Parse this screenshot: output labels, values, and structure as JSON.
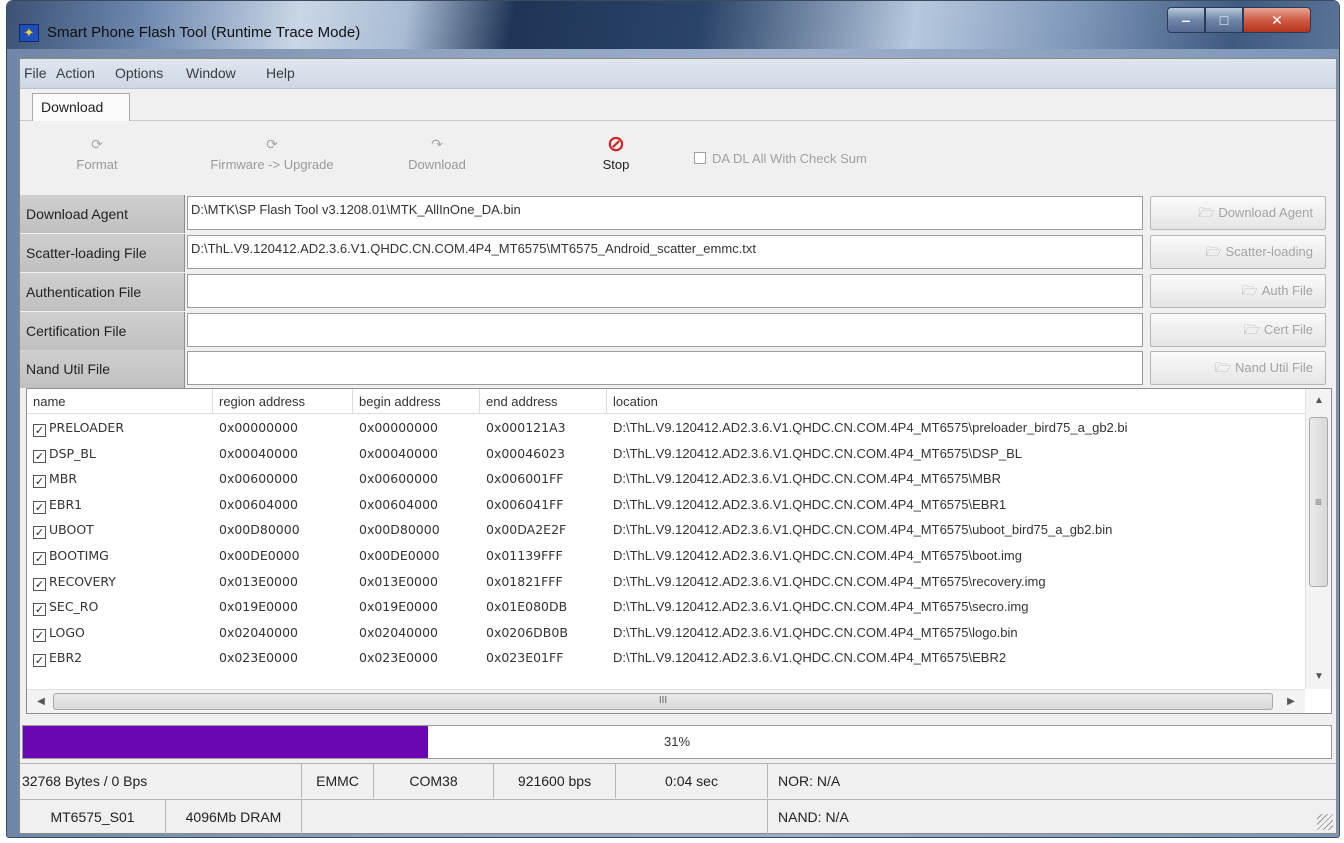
{
  "window": {
    "title": "Smart Phone Flash Tool (Runtime Trace Mode)",
    "minimize_label": "‒",
    "maximize_label": "□",
    "close_label": "✕"
  },
  "menu": [
    "File",
    "Action",
    "Options",
    "Window",
    "Help"
  ],
  "tabs": [
    "Download"
  ],
  "toolbar": {
    "format": "Format",
    "firmware_upgrade": "Firmware -> Upgrade",
    "download": "Download",
    "stop": "Stop",
    "checksum": "DA DL All With Check Sum"
  },
  "fields": {
    "download_agent": {
      "label": "Download Agent",
      "value": "D:\\MTK\\SP Flash Tool v3.1208.01\\MTK_AllInOne_DA.bin",
      "button": "Download Agent"
    },
    "scatter": {
      "label": "Scatter-loading File",
      "value": "D:\\ThL.V9.120412.AD2.3.6.V1.QHDC.CN.COM.4P4_MT6575\\MT6575_Android_scatter_emmc.txt",
      "button": "Scatter-loading"
    },
    "auth": {
      "label": "Authentication File",
      "value": "",
      "button": "Auth File"
    },
    "cert": {
      "label": "Certification File",
      "value": "",
      "button": "Cert File"
    },
    "nand": {
      "label": "Nand Util File",
      "value": "",
      "button": "Nand Util File"
    }
  },
  "table": {
    "columns": [
      "name",
      "region address",
      "begin address",
      "end address",
      "location"
    ],
    "rows": [
      {
        "checked": true,
        "name": "PRELOADER",
        "region": "0x00000000",
        "begin": "0x00000000",
        "end": "0x000121A3",
        "location": "D:\\ThL.V9.120412.AD2.3.6.V1.QHDC.CN.COM.4P4_MT6575\\preloader_bird75_a_gb2.bi"
      },
      {
        "checked": true,
        "name": "DSP_BL",
        "region": "0x00040000",
        "begin": "0x00040000",
        "end": "0x00046023",
        "location": "D:\\ThL.V9.120412.AD2.3.6.V1.QHDC.CN.COM.4P4_MT6575\\DSP_BL"
      },
      {
        "checked": true,
        "name": "MBR",
        "region": "0x00600000",
        "begin": "0x00600000",
        "end": "0x006001FF",
        "location": "D:\\ThL.V9.120412.AD2.3.6.V1.QHDC.CN.COM.4P4_MT6575\\MBR"
      },
      {
        "checked": true,
        "name": "EBR1",
        "region": "0x00604000",
        "begin": "0x00604000",
        "end": "0x006041FF",
        "location": "D:\\ThL.V9.120412.AD2.3.6.V1.QHDC.CN.COM.4P4_MT6575\\EBR1"
      },
      {
        "checked": true,
        "name": "UBOOT",
        "region": "0x00D80000",
        "begin": "0x00D80000",
        "end": "0x00DA2E2F",
        "location": "D:\\ThL.V9.120412.AD2.3.6.V1.QHDC.CN.COM.4P4_MT6575\\uboot_bird75_a_gb2.bin"
      },
      {
        "checked": true,
        "name": "BOOTIMG",
        "region": "0x00DE0000",
        "begin": "0x00DE0000",
        "end": "0x01139FFF",
        "location": "D:\\ThL.V9.120412.AD2.3.6.V1.QHDC.CN.COM.4P4_MT6575\\boot.img"
      },
      {
        "checked": true,
        "name": "RECOVERY",
        "region": "0x013E0000",
        "begin": "0x013E0000",
        "end": "0x01821FFF",
        "location": "D:\\ThL.V9.120412.AD2.3.6.V1.QHDC.CN.COM.4P4_MT6575\\recovery.img"
      },
      {
        "checked": true,
        "name": "SEC_RO",
        "region": "0x019E0000",
        "begin": "0x019E0000",
        "end": "0x01E080DB",
        "location": "D:\\ThL.V9.120412.AD2.3.6.V1.QHDC.CN.COM.4P4_MT6575\\secro.img"
      },
      {
        "checked": true,
        "name": "LOGO",
        "region": "0x02040000",
        "begin": "0x02040000",
        "end": "0x0206DB0B",
        "location": "D:\\ThL.V9.120412.AD2.3.6.V1.QHDC.CN.COM.4P4_MT6575\\logo.bin"
      },
      {
        "checked": true,
        "name": "EBR2",
        "region": "0x023E0000",
        "begin": "0x023E0000",
        "end": "0x023E01FF",
        "location": "D:\\ThL.V9.120412.AD2.3.6.V1.QHDC.CN.COM.4P4_MT6575\\EBR2"
      }
    ]
  },
  "progress": {
    "percent": 31,
    "label": "31%",
    "color": "#6a07b3"
  },
  "status": {
    "bytes": "32768 Bytes / 0 Bps",
    "storage": "EMMC",
    "port": "COM38",
    "baud": "921600 bps",
    "time": "0:04 sec",
    "nor": "NOR: N/A",
    "chip": "MT6575_S01",
    "dram": "4096Mb DRAM",
    "nand": "NAND: N/A"
  },
  "icons": {
    "app": "flash-tool-icon",
    "stop": "stop-icon",
    "folder": "folder-icon",
    "checkbox": "checkbox-checked-icon"
  },
  "scroll_glyphs": {
    "up": "▲",
    "down": "▼",
    "left": "◀",
    "right": "▶",
    "vgrip": "≡",
    "hgrip": "III"
  }
}
